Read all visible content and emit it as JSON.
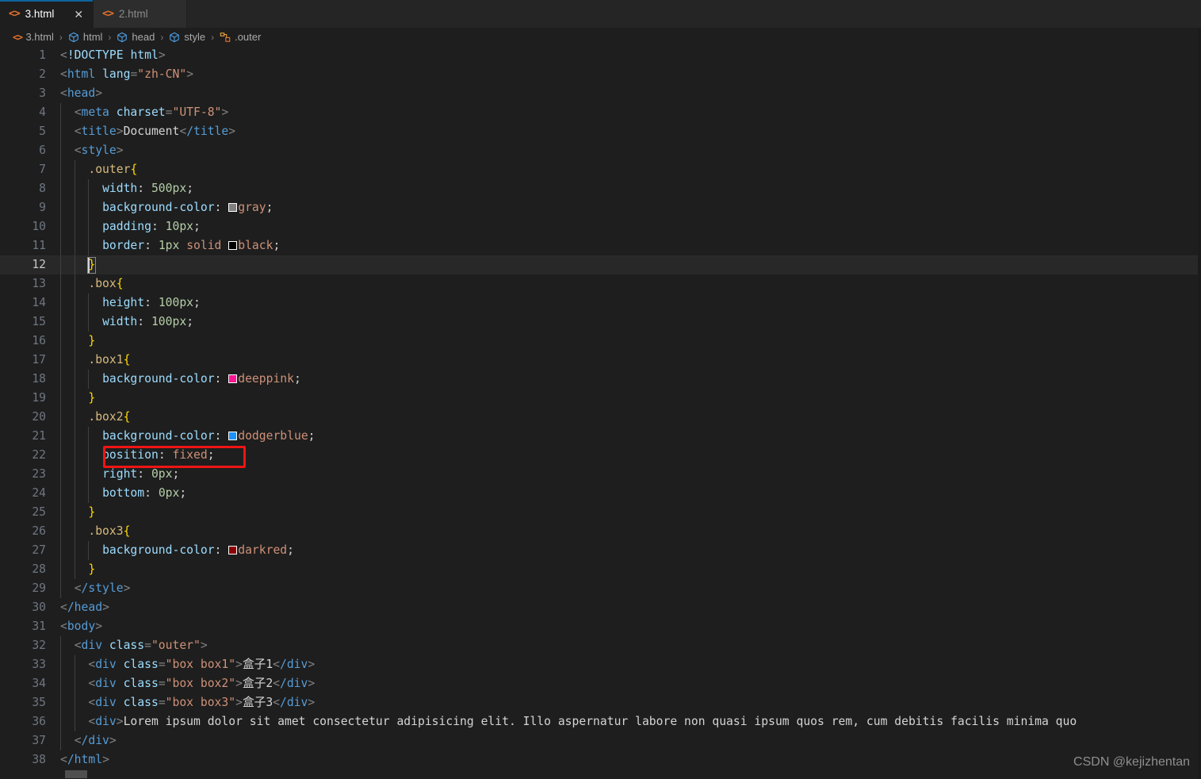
{
  "window": {
    "background": "#1e1e1e",
    "accent": "#0e639c"
  },
  "tabs": [
    {
      "label": "3.html",
      "icon": "html-file-icon",
      "active": true,
      "close_label": "✕"
    },
    {
      "label": "2.html",
      "icon": "html-file-icon",
      "active": false,
      "close_label": "✕"
    }
  ],
  "breadcrumb": {
    "separator": "›",
    "items": [
      {
        "label": "3.html",
        "icon": "html-file-icon"
      },
      {
        "label": "html",
        "icon": "symbol-structure-icon"
      },
      {
        "label": "head",
        "icon": "symbol-structure-icon"
      },
      {
        "label": "style",
        "icon": "symbol-structure-icon"
      },
      {
        "label": ".outer",
        "icon": "symbol-ruler-icon"
      }
    ]
  },
  "editor": {
    "language": "html",
    "active_line": 12,
    "first_line": 1,
    "last_line": 38,
    "line_numbers": [
      "1",
      "2",
      "3",
      "4",
      "5",
      "6",
      "7",
      "8",
      "9",
      "10",
      "11",
      "12",
      "13",
      "14",
      "15",
      "16",
      "17",
      "18",
      "19",
      "20",
      "21",
      "22",
      "23",
      "24",
      "25",
      "26",
      "27",
      "28",
      "29",
      "30",
      "31",
      "32",
      "33",
      "34",
      "35",
      "36",
      "37",
      "38"
    ],
    "lines": [
      "<!DOCTYPE html>",
      "<html lang=\"zh-CN\">",
      "<head>",
      "  <meta charset=\"UTF-8\">",
      "  <title>Document</title>",
      "  <style>",
      "    .outer{",
      "      width: 500px;",
      "      background-color: gray;",
      "      padding: 10px;",
      "      border: 1px solid black;",
      "    }",
      "    .box{",
      "      height: 100px;",
      "      width: 100px;",
      "    }",
      "    .box1{",
      "      background-color: deeppink;",
      "    }",
      "    .box2{",
      "      background-color: dodgerblue;",
      "      position: fixed;",
      "      right: 0px;",
      "      bottom: 0px;",
      "    }",
      "    .box3{",
      "      background-color: darkred;",
      "    }",
      "  </style>",
      "</head>",
      "<body>",
      "  <div class=\"outer\">",
      "    <div class=\"box box1\">盒子1</div>",
      "    <div class=\"box box2\">盒子2</div>",
      "    <div class=\"box box3\">盒子3</div>",
      "    <div>Lorem ipsum dolor sit amet consectetur adipisicing elit. Illo aspernatur labore non quasi ipsum quos rem, cum debitis facilis minima quo",
      "  </div>",
      "</html>"
    ],
    "color_swatches": [
      {
        "line": 9,
        "name": "gray",
        "hex": "#808080"
      },
      {
        "line": 11,
        "name": "black",
        "hex": "#000000"
      },
      {
        "line": 18,
        "name": "deeppink",
        "hex": "#ff1493"
      },
      {
        "line": 21,
        "name": "dodgerblue",
        "hex": "#1e90ff"
      },
      {
        "line": 27,
        "name": "darkred",
        "hex": "#8b0000"
      }
    ]
  },
  "annotation": {
    "highlight_color": "#f01414",
    "target_line": 22,
    "target_text": "position: fixed;"
  },
  "watermark": {
    "text": "CSDN @kejizhentan"
  }
}
